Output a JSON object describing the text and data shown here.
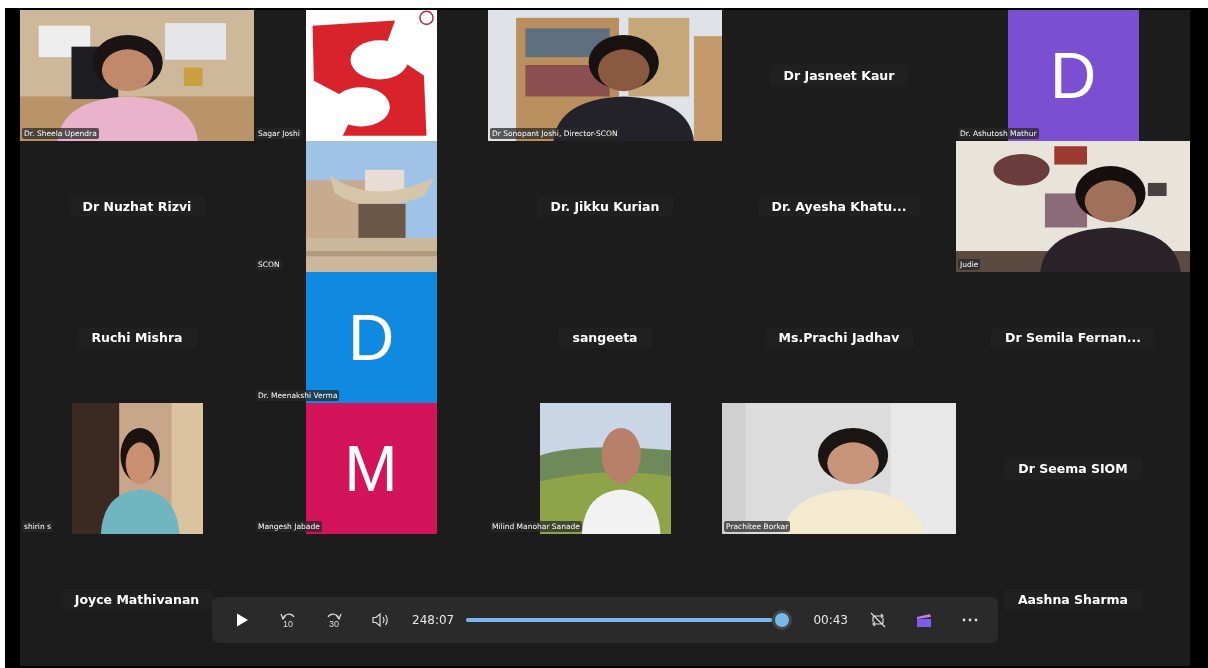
{
  "tiles": [
    {
      "kind": "video",
      "name": "Dr. Sheela Upendra"
    },
    {
      "kind": "square",
      "name": "Sagar Joshi"
    },
    {
      "kind": "video",
      "name": "Dr Sonopant Joshi, Director-SCON"
    },
    {
      "kind": "name",
      "name": "Dr Jasneet Kaur"
    },
    {
      "kind": "avatar",
      "letter": "D",
      "color": "#7b4fd1",
      "name": "Dr. Ashutosh Mathur"
    },
    {
      "kind": "name",
      "name": "Dr Nuzhat Rizvi"
    },
    {
      "kind": "square",
      "name": "SCON"
    },
    {
      "kind": "name",
      "name": "Dr. Jikku Kurian"
    },
    {
      "kind": "name",
      "name": "Dr. Ayesha Khatu..."
    },
    {
      "kind": "video",
      "name": "Judie"
    },
    {
      "kind": "name",
      "name": "Ruchi Mishra"
    },
    {
      "kind": "avatar",
      "letter": "D",
      "color": "#0f8ae0",
      "name": "Dr. Meenakshi Verma"
    },
    {
      "kind": "name",
      "name": "sangeeta"
    },
    {
      "kind": "name",
      "name": "Ms.Prachi Jadhav"
    },
    {
      "kind": "name",
      "name": "Dr Semila Fernan..."
    },
    {
      "kind": "square",
      "name": "shirin s"
    },
    {
      "kind": "avatar",
      "letter": "M",
      "color": "#d3135a",
      "name": "Mangesh Jabade"
    },
    {
      "kind": "square",
      "name": "Milind Manohar Sanade"
    },
    {
      "kind": "video",
      "name": "Prachitee Borkar"
    },
    {
      "kind": "name",
      "name": "Dr Seema SIOM"
    },
    {
      "kind": "name",
      "name": "Joyce Mathivanan"
    },
    {
      "kind": "blank"
    },
    {
      "kind": "blank"
    },
    {
      "kind": "blank"
    },
    {
      "kind": "name",
      "name": "Aashna Sharma"
    }
  ],
  "player": {
    "back_label": "10",
    "forward_label": "30",
    "elapsed": "248:07",
    "level": 0.99,
    "remaining": "00:43"
  }
}
